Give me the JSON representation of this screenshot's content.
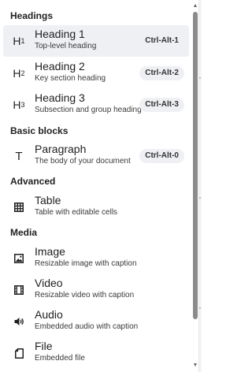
{
  "groups": [
    {
      "title": "Headings"
    },
    {
      "title": "Basic blocks"
    },
    {
      "title": "Advanced"
    },
    {
      "title": "Media"
    }
  ],
  "items": [
    {
      "title": "Heading 1",
      "subtext": "Top-level heading",
      "shortcut": "Ctrl-Alt-1",
      "icon": "heading-1-icon",
      "icon_main": "H",
      "icon_num": "1"
    },
    {
      "title": "Heading 2",
      "subtext": "Key section heading",
      "shortcut": "Ctrl-Alt-2",
      "icon": "heading-2-icon",
      "icon_main": "H",
      "icon_num": "2"
    },
    {
      "title": "Heading 3",
      "subtext": "Subsection and group heading",
      "shortcut": "Ctrl-Alt-3",
      "icon": "heading-3-icon",
      "icon_main": "H",
      "icon_num": "3"
    },
    {
      "title": "Paragraph",
      "subtext": "The body of your document",
      "shortcut": "Ctrl-Alt-0",
      "icon": "text-icon",
      "icon_main": "T"
    },
    {
      "title": "Table",
      "subtext": "Table with editable cells",
      "icon": "table-icon"
    },
    {
      "title": "Image",
      "subtext": "Resizable image with caption",
      "icon": "image-icon"
    },
    {
      "title": "Video",
      "subtext": "Resizable video with caption",
      "icon": "video-icon"
    },
    {
      "title": "Audio",
      "subtext": "Embedded audio with caption",
      "icon": "audio-icon"
    },
    {
      "title": "File",
      "subtext": "Embedded file",
      "icon": "file-icon"
    }
  ],
  "selected_item": "Heading 1",
  "colors": {
    "selected_bg": "#eef0f3",
    "badge_bg": "#eef0f3",
    "scroll_thumb": "#8b8b8b"
  }
}
